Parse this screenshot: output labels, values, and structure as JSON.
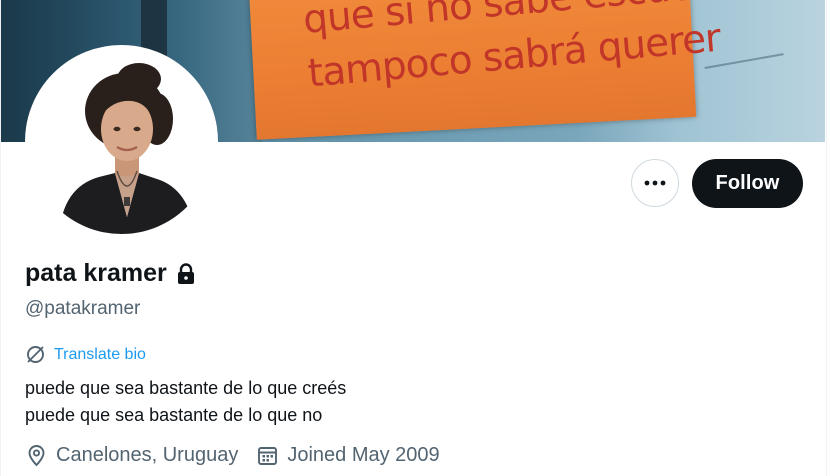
{
  "banner": {
    "sign_line1": "que si no sabe escuchar",
    "sign_line2": "tampoco sabrá querer"
  },
  "profile": {
    "display_name": "pata kramer",
    "handle": "@patakramer",
    "follow_label": "Follow",
    "translate_label": "Translate bio",
    "bio_line1": "puede que sea bastante de lo que creés",
    "bio_line2": "puede que sea bastante de lo que no",
    "location": "Canelones, Uruguay",
    "joined": "Joined May 2009"
  },
  "icons": {
    "more": "more-horizontal-icon",
    "lock": "lock-icon",
    "translate": "translate-icon",
    "location": "location-pin-icon",
    "calendar": "calendar-icon"
  },
  "colors": {
    "link": "#1d9bf0",
    "follow_bg": "#0f1419",
    "secondary_text": "#536471",
    "sign_orange": "#ec7f33",
    "sign_text": "#c2362a"
  }
}
